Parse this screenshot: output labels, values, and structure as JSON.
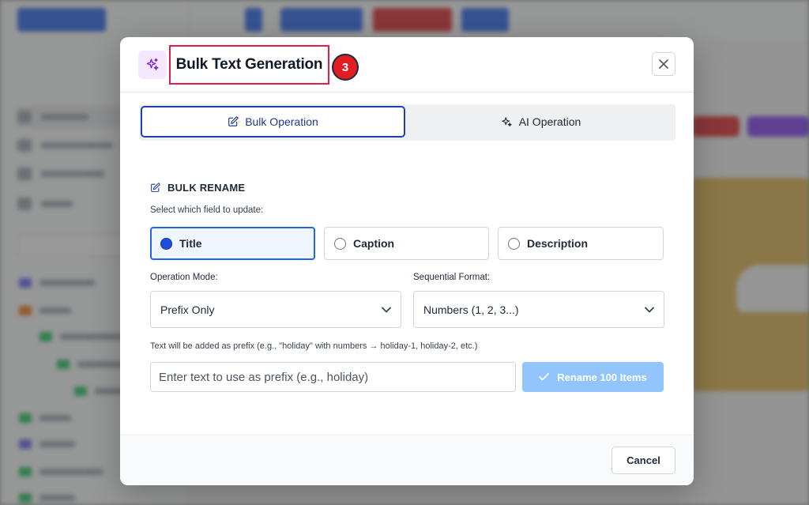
{
  "modal": {
    "title": "Bulk Text Generation",
    "step_number": "3",
    "header_icon": "sparkles-icon",
    "tabs": [
      {
        "label": "Bulk Operation",
        "icon": "edit-icon",
        "active": true
      },
      {
        "label": "AI Operation",
        "icon": "sparkles-icon",
        "active": false
      }
    ],
    "section_title": "BULK RENAME",
    "field_prompt": "Select which field to update:",
    "field_options": [
      {
        "label": "Title",
        "selected": true
      },
      {
        "label": "Caption",
        "selected": false
      },
      {
        "label": "Description",
        "selected": false
      }
    ],
    "operation_mode": {
      "label": "Operation Mode:",
      "value": "Prefix Only"
    },
    "sequential_format": {
      "label": "Sequential Format:",
      "value": "Numbers (1, 2, 3...)"
    },
    "prefix_hint": "Text will be added as prefix (e.g., \"holiday\" with numbers → holiday-1, holiday-2, etc.)",
    "prefix_input": {
      "value": "",
      "placeholder": "Enter text to use as prefix (e.g., holiday)"
    },
    "rename_button": "Rename 100 Items",
    "cancel_button": "Cancel"
  },
  "colors": {
    "accent": "#1e40af",
    "step_badge": "#e11d22",
    "highlight_border": "#e11d48",
    "rename_button_disabled": "#93c5fd"
  }
}
